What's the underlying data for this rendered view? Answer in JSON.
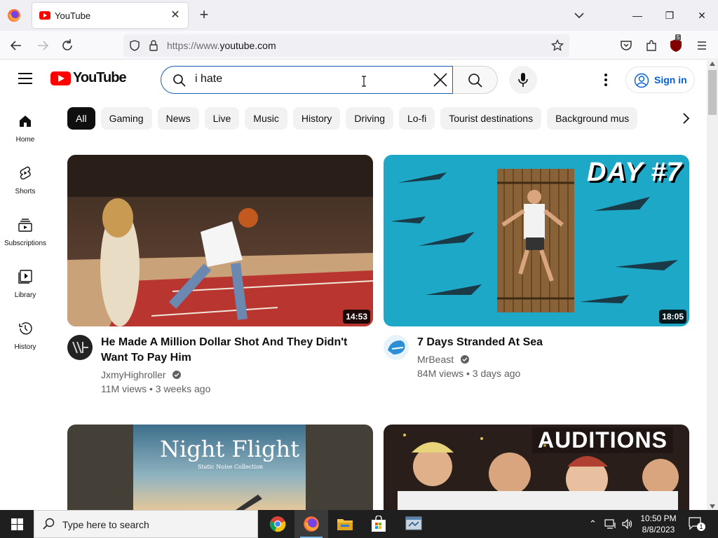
{
  "browser": {
    "tab_title": "YouTube",
    "url_prefix": "https://www.",
    "url_domain": "youtube.com",
    "extension_badge": "5"
  },
  "youtube": {
    "logo_text": "YouTube",
    "search_value": "i hate",
    "sign_in_label": "Sign in"
  },
  "sidebar": {
    "items": [
      {
        "label": "Home"
      },
      {
        "label": "Shorts"
      },
      {
        "label": "Subscriptions"
      },
      {
        "label": "Library"
      },
      {
        "label": "History"
      }
    ]
  },
  "chips": [
    "All",
    "Gaming",
    "News",
    "Live",
    "Music",
    "History",
    "Driving",
    "Lo-fi",
    "Tourist destinations",
    "Background mus"
  ],
  "videos": [
    {
      "title": "He Made A Million Dollar Shot And They Didn't Want To Pay Him",
      "channel": "JxmyHighroller",
      "meta": "11M views • 3 weeks ago",
      "duration": "14:53"
    },
    {
      "title": "7 Days Stranded At Sea",
      "channel": "MrBeast",
      "meta": "84M views • 3 days ago",
      "duration": "18:05",
      "thumb_overlay": "DAY #7"
    },
    {
      "thumb_title": "Night Flight",
      "thumb_subtitle": "Static Noise Collection"
    },
    {
      "thumb_overlay": "AUDITIONS"
    }
  ],
  "taskbar": {
    "search_placeholder": "Type here to search",
    "time": "10:50 PM",
    "date": "8/8/2023",
    "notification_count": "1"
  },
  "colors": {
    "yt_red": "#ff0000",
    "link_blue": "#065fd4",
    "search_focus": "#1c62b9"
  }
}
